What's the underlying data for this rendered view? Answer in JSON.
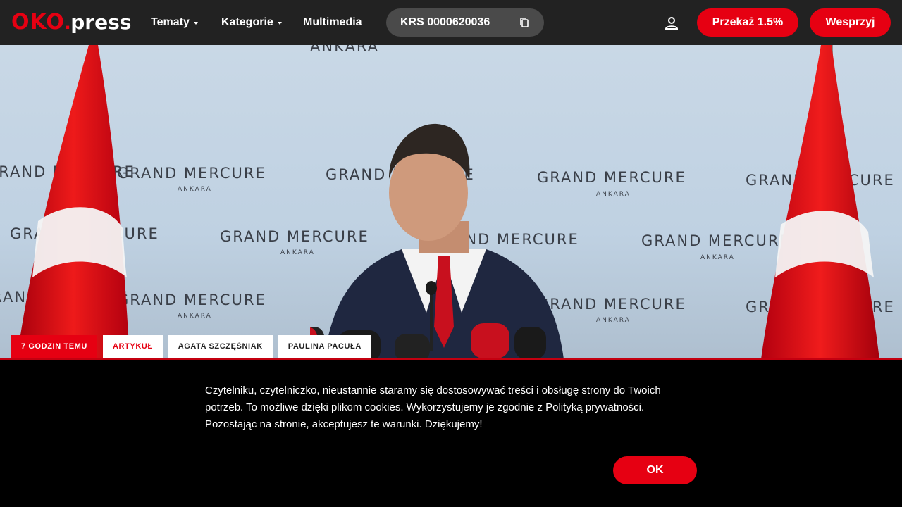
{
  "logo": {
    "oko": "OKO",
    "press": "press"
  },
  "nav": {
    "items": [
      {
        "label": "Tematy"
      },
      {
        "label": "Kategorie"
      },
      {
        "label": "Multimedia"
      }
    ],
    "krs": "KRS 0000620036",
    "donate_label": "Przekaż 1.5%",
    "support_label": "Wesprzyj"
  },
  "hero": {
    "backdrop": {
      "brand": "GRAND MERCURE",
      "city": "ANKARA"
    }
  },
  "tags": [
    {
      "label": "7 GODZIN TEMU"
    },
    {
      "label": "ARTYKUŁ"
    },
    {
      "label": "AGATA SZCZĘŚNIAK"
    },
    {
      "label": "PAULINA PACUŁA"
    }
  ],
  "cookie": {
    "text": "Czytelniku, czytelniczko, nieustannie staramy się dostosowywać treści i obsługę strony do Twoich potrzeb. To możliwe dzięki plikom cookies. Wykorzystujemy je zgodnie z Polityką prywatności. Pozostając na stronie, akceptujesz te warunki. Dziękujemy!",
    "ok_label": "OK"
  },
  "colors": {
    "accent": "#e60012",
    "nav_bg": "#222222",
    "krs_bg": "#4a4a4a"
  }
}
